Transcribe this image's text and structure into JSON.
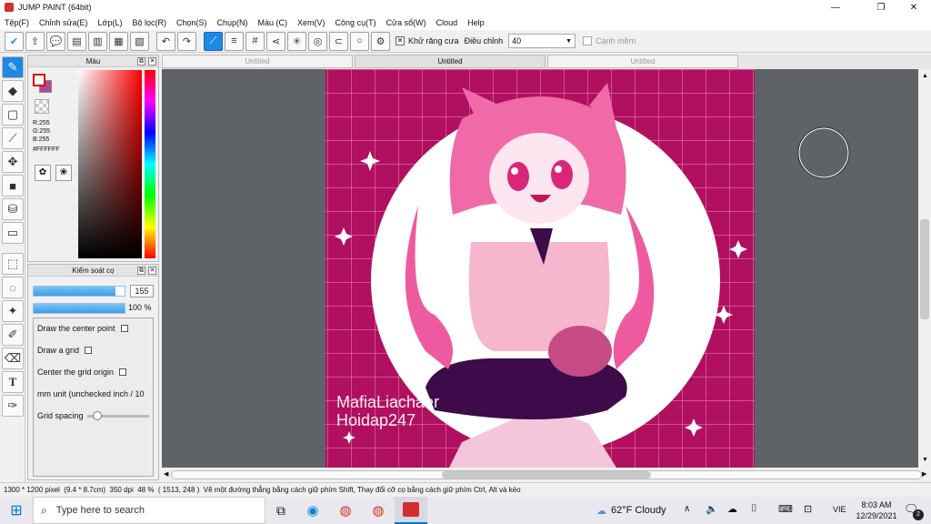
{
  "window": {
    "title": "JUMP PAINT (64bit)"
  },
  "menu": [
    "Tệp(F)",
    "Chỉnh sửa(E)",
    "Lớp(L)",
    "Bộ lọc(R)",
    "Chọn(S)",
    "Chụp(N)",
    "Màu (C)",
    "Xem(V)",
    "Công cụ(T)",
    "Cửa sổ(W)",
    "Cloud",
    "Help"
  ],
  "toolbar": {
    "antialias_label": "Khử răng cưa",
    "adjust_label": "Điều chỉnh",
    "adjust_value": "40",
    "border_label": "Cạnh mềm"
  },
  "color_panel": {
    "title": "Màu",
    "r": "R:255",
    "g": "G:255",
    "b": "B:255",
    "hex": "#FFFFFF",
    "primary_color": "#ffffff",
    "secondary_color": "#b0479a"
  },
  "brush_panel": {
    "title": "Kiểm soát cọ",
    "size_value": "155",
    "opacity_value": "100 %",
    "size_fill": 0.9,
    "opacity_fill": 1.0,
    "options": [
      "Draw the center point",
      "Draw a grid",
      "Center the grid origin",
      "mm unit (unchecked inch / 10"
    ],
    "grid_spacing_label": "Grid spacing"
  },
  "tabs": [
    {
      "label": "Untitled",
      "active": false
    },
    {
      "label": "Untitled",
      "active": true
    },
    {
      "label": "Untitled",
      "active": false
    }
  ],
  "watermark": {
    "line1": "MafiaLiachaer",
    "line2": "Hoidap247"
  },
  "status": {
    "size": "1300 * 1200 pixel",
    "physical": "(9.4 * 8.7cm)",
    "dpi": "350 dpi",
    "zoom": "48 %",
    "coords": "( 1513, 248 )",
    "hint": "Vẽ một đường thẳng bằng cách giữ phím Shift, Thay đổi cỡ cọ bằng cách giữ phím Ctrl, Alt và kéo"
  },
  "taskbar": {
    "search_placeholder": "Type here to search",
    "weather_temp": "62°F",
    "weather_text": "Cloudy",
    "lang": "VIE",
    "time": "8:03 AM",
    "date": "12/29/2021",
    "notif_count": "2"
  },
  "colors": {
    "accent": "#1e88e5",
    "canvas_bg": "#b0105f"
  }
}
